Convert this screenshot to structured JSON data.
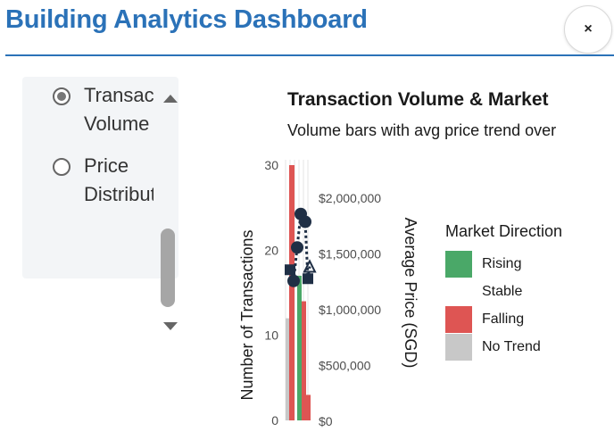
{
  "header": {
    "title": "Building Analytics Dashboard",
    "close_label": "×"
  },
  "sidebar": {
    "options": [
      {
        "label": "Transaction Volume",
        "checked": true
      },
      {
        "label": "Price Distribution",
        "checked": false
      }
    ]
  },
  "chart_data": {
    "type": "bar",
    "title": "Transaction Volume & Market",
    "subtitle": "Volume bars with avg price trend over",
    "ylabel": "Number of Transactions",
    "y2label": "Average Price (SGD)",
    "yticks": [
      "0",
      "10",
      "20",
      "30"
    ],
    "y2ticks": [
      "$0",
      "$500,000",
      "$1,000,000",
      "$1,500,000",
      "$2,000,000"
    ],
    "ylim": [
      0,
      30
    ],
    "y2lim": [
      0,
      2000000
    ],
    "grid": true,
    "legend": {
      "title": "Market Direction",
      "position": "right",
      "entries": [
        {
          "label": "Rising",
          "color": "#4aa868"
        },
        {
          "label": "Stable",
          "color": "#ffffff"
        },
        {
          "label": "Falling",
          "color": "#de5553"
        },
        {
          "label": "No Trend",
          "color": "#c8c8c8"
        }
      ]
    },
    "bars": [
      {
        "direction": "No Trend",
        "value": 12
      },
      {
        "direction": "Falling",
        "value": 30
      },
      {
        "direction": "Rising",
        "value": 17
      },
      {
        "direction": "Falling",
        "value": 14
      },
      {
        "direction": "Falling",
        "value": 3
      }
    ],
    "price_points": [
      {
        "shape": "square",
        "value": 1350000
      },
      {
        "shape": "circle",
        "value": 1250000
      },
      {
        "shape": "circle",
        "value": 1550000
      },
      {
        "shape": "circle",
        "value": 1850000
      },
      {
        "shape": "circle",
        "value": 1780000
      },
      {
        "shape": "square",
        "value": 1270000
      },
      {
        "shape": "triangle",
        "value": 1380000
      }
    ]
  }
}
